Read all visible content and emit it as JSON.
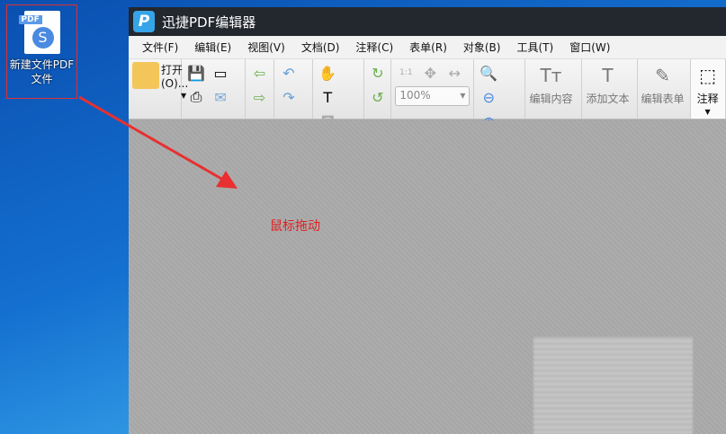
{
  "desktop": {
    "icon_label": "新建文件PDF文件",
    "icon_badge": "PDF"
  },
  "window": {
    "title": "迅捷PDF编辑器",
    "logo": "P"
  },
  "menu": [
    "文件(F)",
    "编辑(E)",
    "视图(V)",
    "文档(D)",
    "注释(C)",
    "表单(R)",
    "对象(B)",
    "工具(T)",
    "窗口(W)"
  ],
  "toolbar": {
    "open": "打开(O)...",
    "zoom": "100%",
    "edit_content": "编辑内容",
    "add_text": "添加文本",
    "edit_form": "编辑表单",
    "annotate": "注释"
  },
  "annotation": {
    "text": "鼠标拖动",
    "color": "#e02020"
  }
}
